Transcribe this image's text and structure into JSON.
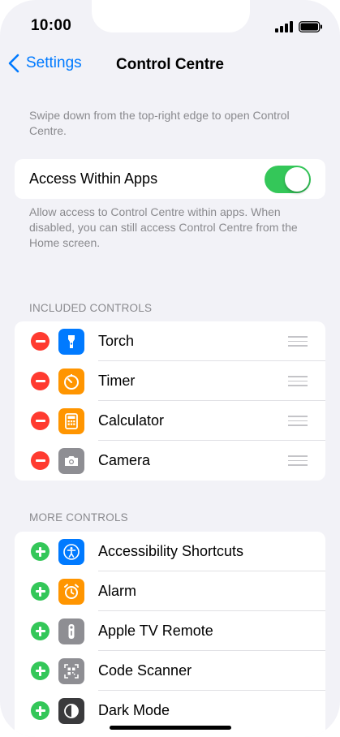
{
  "status": {
    "time": "10:00"
  },
  "nav": {
    "back_label": "Settings",
    "title": "Control Centre"
  },
  "intro": "Swipe down from the top-right edge to open Control Centre.",
  "access_within_apps": {
    "label": "Access Within Apps",
    "enabled": true,
    "footer": "Allow access to Control Centre within apps. When disabled, you can still access Control Centre from the Home screen."
  },
  "included": {
    "header": "INCLUDED CONTROLS",
    "items": [
      {
        "label": "Torch",
        "icon": "torch-icon",
        "color": "#007aff"
      },
      {
        "label": "Timer",
        "icon": "timer-icon",
        "color": "#ff9500"
      },
      {
        "label": "Calculator",
        "icon": "calculator-icon",
        "color": "#ff9500"
      },
      {
        "label": "Camera",
        "icon": "camera-icon",
        "color": "#8e8e93"
      }
    ]
  },
  "more": {
    "header": "MORE CONTROLS",
    "items": [
      {
        "label": "Accessibility Shortcuts",
        "icon": "accessibility-icon",
        "color": "#007aff"
      },
      {
        "label": "Alarm",
        "icon": "alarm-icon",
        "color": "#ff9500"
      },
      {
        "label": "Apple TV Remote",
        "icon": "tv-remote-icon",
        "color": "#8e8e93"
      },
      {
        "label": "Code Scanner",
        "icon": "qr-code-icon",
        "color": "#8e8e93"
      },
      {
        "label": "Dark Mode",
        "icon": "dark-mode-icon",
        "color": "#3a3a3c"
      }
    ]
  },
  "colors": {
    "accent": "#007aff",
    "toggle_on": "#34c759",
    "remove": "#ff3b30",
    "add": "#34c759"
  }
}
